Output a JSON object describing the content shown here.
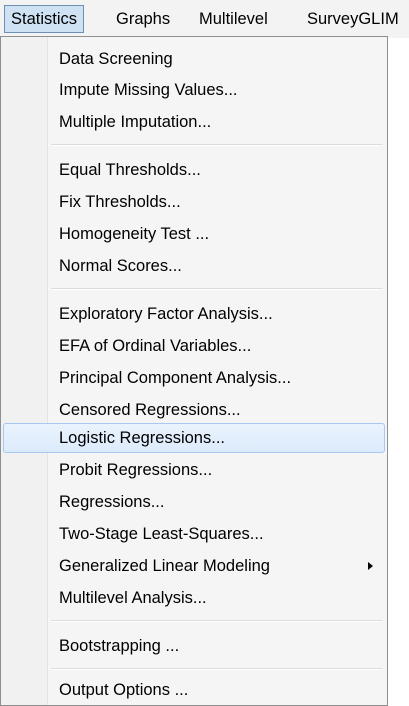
{
  "menubar": {
    "items": [
      {
        "label": "Statistics",
        "active": true
      },
      {
        "label": "Graphs"
      },
      {
        "label": "Multilevel"
      },
      {
        "label": "SurveyGLIM"
      }
    ]
  },
  "dropdown": {
    "items": [
      "Data Screening",
      "Impute Missing Values...",
      "Multiple Imputation...",
      "Equal Thresholds...",
      "Fix Thresholds...",
      "Homogeneity Test ...",
      "Normal Scores...",
      "Exploratory Factor Analysis...",
      "EFA of Ordinal Variables...",
      "Principal Component Analysis...",
      "Censored Regressions...",
      "Logistic Regressions...",
      "Probit Regressions...",
      "Regressions...",
      "Two-Stage Least-Squares...",
      "Generalized Linear Modeling",
      "Multilevel Analysis...",
      "Bootstrapping ...",
      "Output Options ..."
    ],
    "highlighted_item": "Logistic Regressions...",
    "submenu_item": "Generalized Linear Modeling"
  }
}
